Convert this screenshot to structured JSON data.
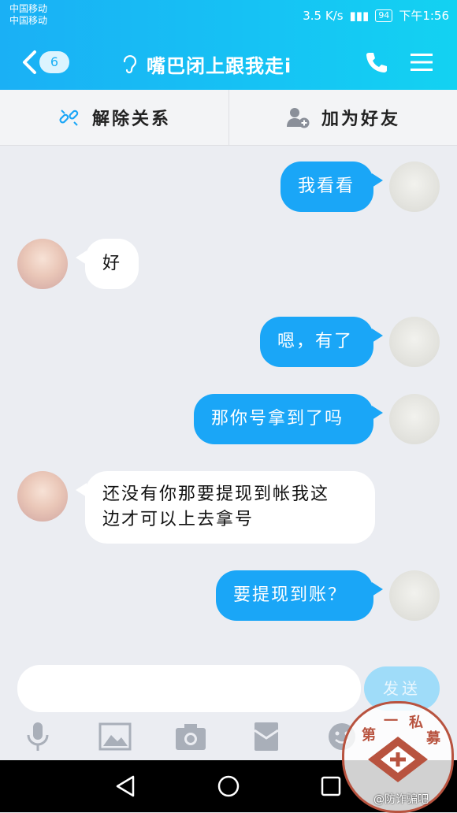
{
  "status": {
    "carrier1": "中国移动",
    "carrier2": "中国移动",
    "speed": "3.5 K/s",
    "battery": "94",
    "time": "下午1:56"
  },
  "header": {
    "unread_badge": "6",
    "title": "嘴巴闭上跟我走i"
  },
  "actions": {
    "unbind_label": "解除关系",
    "add_friend_label": "加为好友"
  },
  "messages": [
    {
      "side": "out",
      "text": "我看看"
    },
    {
      "side": "in",
      "text": "好"
    },
    {
      "side": "out",
      "text": "嗯，有了"
    },
    {
      "side": "out",
      "text": "那你号拿到了吗"
    },
    {
      "side": "in",
      "text_line1": "还没有你那要提现到帐我这",
      "text_line2": "边才可以上去拿号"
    },
    {
      "side": "out",
      "text": "要提现到账？"
    }
  ],
  "composer": {
    "input_value": "",
    "send_label": "发送"
  },
  "watermark": {
    "chars": [
      "第",
      "一",
      "私",
      "募"
    ],
    "caption": "@防诈骗吧"
  },
  "colors": {
    "header_start": "#1ab0f5",
    "header_end": "#13d2f2",
    "bubble_out": "#1aa6f7",
    "bubble_in": "#ffffff",
    "background": "#ebedf2"
  },
  "icons": {
    "back": "chevron-left-icon",
    "ear": "ear-icon",
    "phone": "phone-icon",
    "menu": "menu-icon",
    "unbind": "broken-link-icon",
    "add_friend": "add-person-icon",
    "mic": "microphone-icon",
    "image": "image-icon",
    "camera": "camera-icon",
    "red_packet": "red-packet-icon",
    "emoji": "emoji-icon"
  }
}
